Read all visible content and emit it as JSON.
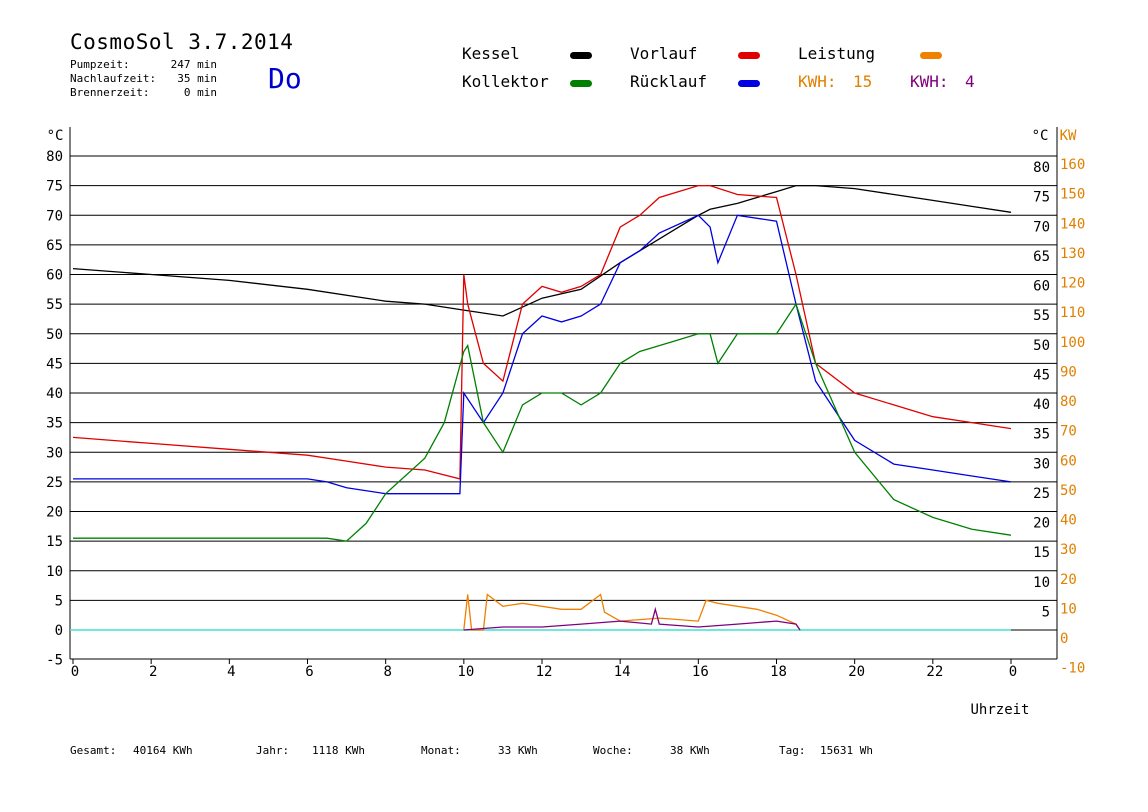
{
  "header": {
    "title": "CosmoSol 3.7.2014",
    "stats": [
      {
        "label": "Pumpzeit:",
        "value": "247 min"
      },
      {
        "label": "Nachlaufzeit:",
        "value": "35 min"
      },
      {
        "label": "Brennerzeit:",
        "value": "0 min"
      }
    ],
    "day": "Do"
  },
  "legend": [
    {
      "name": "Kessel",
      "color": "#000000"
    },
    {
      "name": "Kollektor",
      "color": "#008000"
    },
    {
      "name": "Vorlauf",
      "color": "#e00000"
    },
    {
      "name": "Rücklauf",
      "color": "#0000e0"
    },
    {
      "name": "Leistung",
      "color": "#f08000"
    }
  ],
  "kwh": [
    {
      "label": "KWH:",
      "value": "15",
      "color": "#e08000"
    },
    {
      "label": "KWH:",
      "value": "4",
      "color": "#800080"
    }
  ],
  "footer": [
    {
      "label": "Gesamt:",
      "value": "40164 KWh"
    },
    {
      "label": "Jahr:",
      "value": "1118 KWh"
    },
    {
      "label": "Monat:",
      "value": "33 KWh"
    },
    {
      "label": "Woche:",
      "value": "38 KWh"
    },
    {
      "label": "Tag:",
      "value": "15631 Wh"
    }
  ],
  "chart_data": {
    "type": "line",
    "xlabel": "Uhrzeit",
    "ylabel_left": "°C",
    "ylabel_right_temp": "°C",
    "ylabel_right_power": "KW",
    "xlim": [
      0,
      24
    ],
    "ylim": [
      -5,
      80
    ],
    "xticks": [
      "0",
      "2",
      "4",
      "6",
      "8",
      "10",
      "12",
      "14",
      "16",
      "18",
      "20",
      "22",
      "0"
    ],
    "yticks_left": [
      "80",
      "75",
      "70",
      "65",
      "60",
      "55",
      "50",
      "45",
      "40",
      "35",
      "30",
      "25",
      "20",
      "15",
      "10",
      "5",
      "0",
      "-5"
    ],
    "yticks_right_temp": [
      "80",
      "75",
      "70",
      "65",
      "60",
      "55",
      "50",
      "45",
      "40",
      "35",
      "30",
      "25",
      "20",
      "15",
      "10",
      "5",
      "0"
    ],
    "yticks_right_power": [
      "160",
      "150",
      "140",
      "130",
      "120",
      "110",
      "100",
      "90",
      "80",
      "70",
      "60",
      "50",
      "40",
      "30",
      "20",
      "10",
      "0",
      "-10"
    ],
    "zero_line_color": "#40e0d0",
    "series": [
      {
        "name": "Kessel",
        "color": "#000000",
        "x": [
          0,
          2,
          4,
          6,
          8,
          9,
          10,
          11,
          12,
          13,
          14,
          14.5,
          15,
          15.5,
          16,
          16.3,
          17,
          18,
          18.5,
          19,
          20,
          21,
          22,
          23,
          24
        ],
        "y": [
          61,
          60,
          59,
          57.5,
          55.5,
          55,
          54,
          53,
          56,
          57.5,
          62,
          64,
          66,
          68,
          70,
          71,
          72,
          74,
          75,
          75,
          74.5,
          73.5,
          72.5,
          71.5,
          70.5
        ]
      },
      {
        "name": "Vorlauf",
        "color": "#e00000",
        "x": [
          0,
          2,
          4,
          6,
          7,
          8,
          9,
          9.9,
          10,
          10.1,
          10.5,
          11,
          11.5,
          12,
          12.5,
          13,
          13.5,
          14,
          14.5,
          15,
          16,
          16.3,
          17,
          18,
          18.5,
          19,
          20,
          21,
          22,
          23,
          24
        ],
        "y": [
          32.5,
          31.5,
          30.5,
          29.5,
          28.5,
          27.5,
          27,
          25.5,
          60,
          55,
          45,
          42,
          55,
          58,
          57,
          58,
          60,
          68,
          70,
          73,
          75,
          75,
          73.5,
          73,
          60,
          45,
          40,
          38,
          36,
          35,
          34
        ]
      },
      {
        "name": "Rücklauf",
        "color": "#0000e0",
        "x": [
          0,
          2,
          4,
          6,
          6.5,
          7,
          8,
          9,
          9.9,
          10,
          10.5,
          11,
          11.5,
          12,
          12.5,
          13,
          13.5,
          14,
          14.5,
          15,
          16,
          16.3,
          16.5,
          17,
          18,
          18.5,
          19,
          20,
          21,
          22,
          23,
          24
        ],
        "y": [
          25.5,
          25.5,
          25.5,
          25.5,
          25,
          24,
          23,
          23,
          23,
          40,
          35,
          40,
          50,
          53,
          52,
          53,
          55,
          62,
          64,
          67,
          70,
          68,
          62,
          70,
          69,
          55,
          42,
          32,
          28,
          27,
          26,
          25
        ]
      },
      {
        "name": "Kollektor",
        "color": "#008000",
        "x": [
          0,
          2,
          4,
          6,
          6.5,
          7,
          7.5,
          8,
          9,
          9.5,
          10,
          10.1,
          10.5,
          11,
          11.5,
          12,
          12.5,
          13,
          13.5,
          14,
          14.5,
          15,
          15.5,
          16,
          16.3,
          16.5,
          17,
          17.5,
          18,
          18.5,
          19,
          20,
          21,
          22,
          23,
          24
        ],
        "y": [
          15.5,
          15.5,
          15.5,
          15.5,
          15.5,
          15,
          18,
          23,
          29,
          35,
          47,
          48,
          35,
          30,
          38,
          40,
          40,
          38,
          40,
          45,
          47,
          48,
          49,
          50,
          50,
          45,
          50,
          50,
          50,
          55,
          45,
          30,
          22,
          19,
          17,
          16
        ]
      },
      {
        "name": "Leistung",
        "color": "#f08000",
        "unit": "KW",
        "x": [
          10,
          10.1,
          10.2,
          10.5,
          10.6,
          11,
          11.5,
          12,
          12.5,
          13,
          13.5,
          13.6,
          14,
          15,
          16,
          16.2,
          16.5,
          17,
          17.5,
          18,
          18.5,
          18.6
        ],
        "y": [
          0,
          12,
          0,
          0,
          12,
          8,
          9,
          8,
          7,
          7,
          12,
          6,
          3,
          4,
          3,
          10,
          9,
          8,
          7,
          5,
          2,
          0
        ]
      },
      {
        "name": "KWH 4",
        "color": "#800080",
        "unit": "KW",
        "x": [
          10,
          11,
          12,
          13,
          14,
          14.8,
          14.9,
          15,
          16,
          17,
          18,
          18.5,
          18.6
        ],
        "y": [
          0,
          1,
          1,
          2,
          3,
          2,
          7,
          2,
          1,
          2,
          3,
          2,
          0
        ]
      }
    ]
  }
}
